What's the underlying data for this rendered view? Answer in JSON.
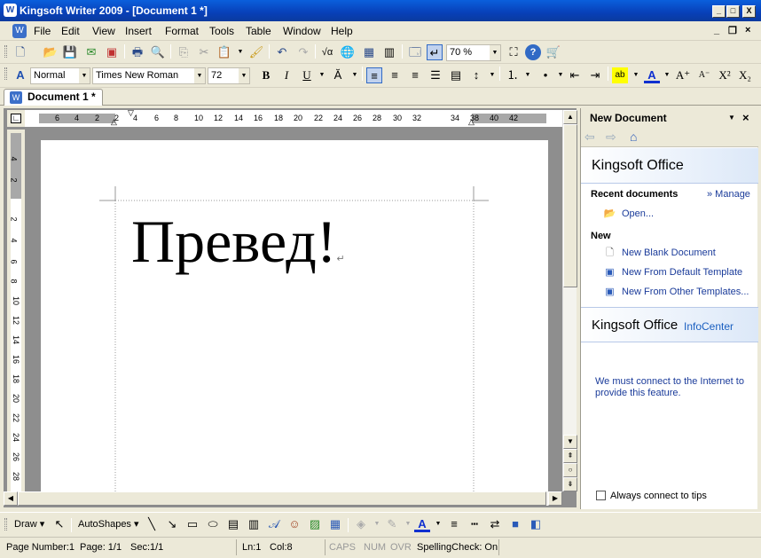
{
  "window": {
    "title": "Kingsoft Writer 2009 - [Document 1 *]",
    "min": "_",
    "max": "□",
    "close": "X"
  },
  "menu": [
    "File",
    "Edit",
    "View",
    "Insert",
    "Format",
    "Tools",
    "Table",
    "Window",
    "Help"
  ],
  "mdi": {
    "min": "_",
    "restore": "❐",
    "close": "×"
  },
  "toolbar": {
    "zoom": "70 %"
  },
  "format": {
    "style": "Normal",
    "font": "Times New Roman",
    "size": "72"
  },
  "tab": {
    "label": "Document 1 *",
    "close": "×"
  },
  "ruler": {
    "h_ticks": [
      "6",
      "4",
      "2",
      "2",
      "4",
      "6",
      "8",
      "10",
      "12",
      "14",
      "16",
      "18",
      "20",
      "22",
      "24",
      "26",
      "28",
      "30",
      "32",
      "34",
      "38",
      "40",
      "42"
    ],
    "v_ticks": [
      "4",
      "2",
      "2",
      "4",
      "6",
      "8",
      "10",
      "12",
      "14",
      "16",
      "18",
      "20",
      "22",
      "24",
      "26",
      "28"
    ]
  },
  "document": {
    "text": "Превед!",
    "para_mark": "↵"
  },
  "taskpane": {
    "title": "New Document",
    "brand": "Kingsoft Office",
    "recent": "Recent documents",
    "manage": "» Manage",
    "open": "Open...",
    "new_heading": "New",
    "new_blank": "New Blank Document",
    "new_default": "New From Default Template",
    "new_other": "New From Other Templates...",
    "info_brand": "Kingsoft Office",
    "info_center": "InfoCenter",
    "info_msg": "We must connect to the Internet to provide this feature.",
    "always": "Always connect to tips"
  },
  "drawbar": {
    "draw": "Draw",
    "autoshapes": "AutoShapes"
  },
  "status": {
    "page_number": "Page Number:1",
    "page": "Page: 1/1",
    "sec": "Sec:1/1",
    "ln": "Ln:1",
    "col": "Col:8",
    "caps": "CAPS",
    "num": "NUM",
    "ovr": "OVR",
    "spell": "SpellingCheck: On"
  }
}
